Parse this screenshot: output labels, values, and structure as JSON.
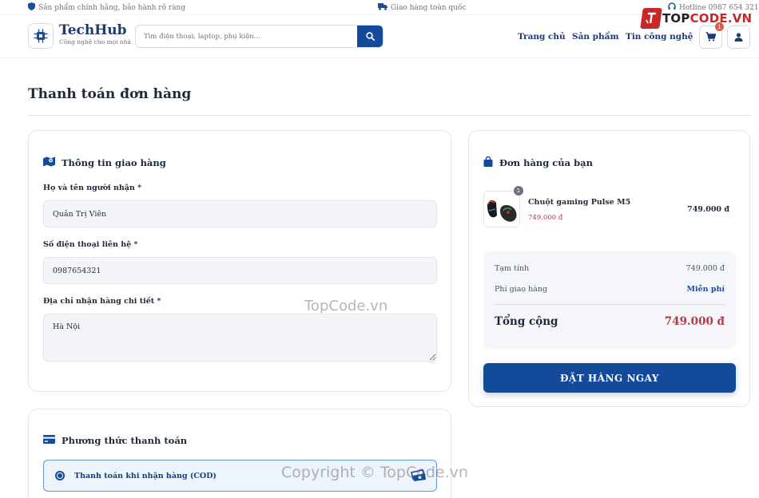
{
  "topbar": {
    "warranty": "Sản phẩm chính hãng, bảo hành rõ ràng",
    "shipping": "Giao hàng toàn quốc",
    "hotline": "Hotline 0987 654 321"
  },
  "header": {
    "brand_name": "TechHub",
    "brand_tagline": "Công nghệ cho mọi nhà",
    "search_placeholder": "Tìm điện thoại, laptop, phụ kiện...",
    "nav": [
      "Trang chủ",
      "Sản phẩm",
      "Tin công nghệ"
    ],
    "cart_count": "1"
  },
  "page": {
    "title": "Thanh toán đơn hàng"
  },
  "shipping": {
    "heading": "Thông tin giao hàng",
    "name_label": "Họ và tên người nhận *",
    "name_value": "Quản Trị Viên",
    "phone_label": "Số điện thoại liên hệ *",
    "phone_value": "0987654321",
    "address_label": "Địa chỉ nhận hàng chi tiết *",
    "address_value": "Hà Nội"
  },
  "payment": {
    "heading": "Phương thức thanh toán",
    "option_cod": "Thanh toán khi nhận hàng (COD)"
  },
  "order": {
    "heading": "Đơn hàng của bạn",
    "item": {
      "name": "Chuột gaming Pulse M5",
      "quantity": "1",
      "unit_price": "749.000 đ",
      "line_total": "749.000 đ"
    },
    "subtotal_label": "Tạm tính",
    "subtotal_value": "749.000 đ",
    "shipping_label": "Phí giao hàng",
    "shipping_value": "Miễn phí",
    "total_label": "Tổng cộng",
    "total_value": "749.000 đ",
    "submit_label": "ĐẶT HÀNG NGAY"
  },
  "overlay": {
    "logo_prefix": "TOP",
    "logo_suffix": "CODE.VN",
    "watermark_center": "TopCode.vn",
    "watermark_bottom": "Copyright © TopCode.vn"
  },
  "colors": {
    "primary": "#134a9a",
    "price": "#b03a48",
    "badge": "#e05b4b"
  },
  "icons": {
    "warranty": "shield-icon",
    "shipping": "truck-icon",
    "hotline": "headset-icon",
    "logo": "chip-icon",
    "search": "search-icon",
    "cart": "cart-icon",
    "user": "user-icon",
    "shipping_heading": "map-icon",
    "payment_heading": "credit-card-icon",
    "order_heading": "shopping-bag-icon",
    "cod": "cash-icon"
  }
}
